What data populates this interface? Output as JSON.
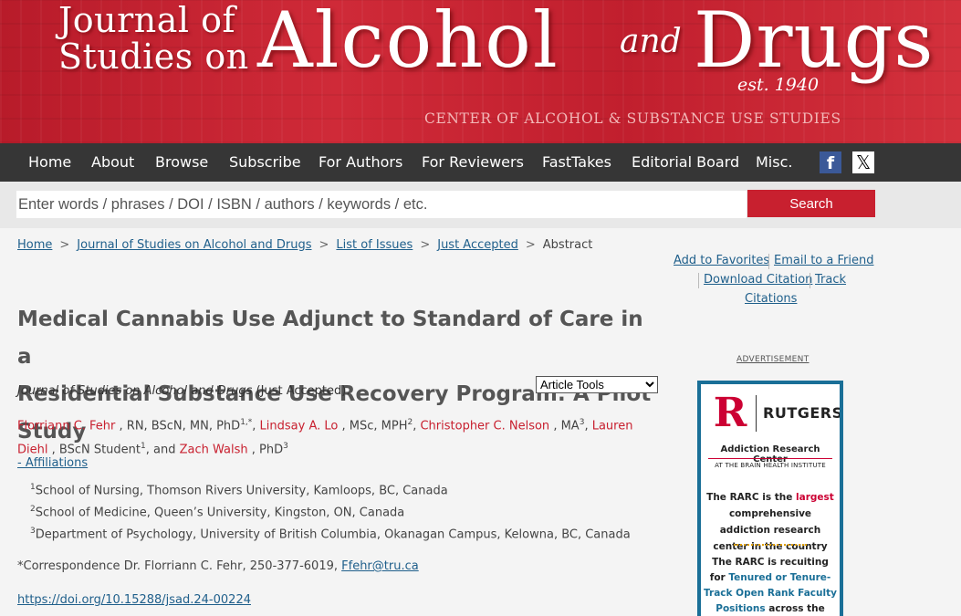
{
  "banner": {
    "journal_of": "Journal of",
    "studies_on": "Studies on",
    "alcohol": "Alcohol",
    "and": "and",
    "drugs": "Drugs",
    "est": "est. 1940",
    "center": "CENTER OF ALCOHOL & SUBSTANCE USE STUDIES"
  },
  "nav": {
    "items": [
      "Home",
      "About",
      "Browse",
      "Subscribe",
      "For Authors",
      "For Reviewers",
      "FastTakes",
      "Editorial Board",
      "Misc."
    ],
    "facebook": "f",
    "x": "𝕏"
  },
  "search": {
    "placeholder": "Enter words / phrases / DOI / ISBN / authors / keywords / etc.",
    "button": "Search"
  },
  "breadcrumb": {
    "home": "Home",
    "journal": "Journal of Studies on Alcohol and Drugs",
    "issues": "List of Issues",
    "accepted": "Just Accepted",
    "current": "Abstract"
  },
  "actions": {
    "favorites": "Add to Favorites",
    "email": "Email to a Friend",
    "download": "Download Citation",
    "track": "Track",
    "citations": "Citations"
  },
  "article": {
    "title_line1": "Medical Cannabis Use Adjunct to Standard of Care in a",
    "title_line2": "Residential Substance Use Recovery Program: A Pilot Study",
    "journal": "Journal of Studies on Alcohol and Drugs",
    "status": "(Just Accepted).",
    "tools_selected": "Article Tools",
    "authors": [
      {
        "name": "Florriann C. Fehr",
        "cred": " , RN, BScN, MN, PhD",
        "sup": "1,*"
      },
      {
        "name": "Lindsay A. Lo",
        "cred": " , MSc, MPH",
        "sup": "2"
      },
      {
        "name": "Christopher C. Nelson",
        "cred": " , MA",
        "sup": "3"
      },
      {
        "name": "Lauren Diehl",
        "cred": " , BScN Student",
        "sup": "1"
      },
      {
        "name": "Zach Walsh",
        "cred": " , PhD",
        "sup": "3"
      }
    ],
    "and_word": "and",
    "affiliations_toggle": "- Affiliations",
    "affiliations": [
      {
        "sup": "1",
        "text": "School of Nursing, Thomson Rivers University, Kamloops, BC, Canada"
      },
      {
        "sup": "2",
        "text": "School of Medicine, Queen’s University, Kingston, ON, Canada"
      },
      {
        "sup": "3",
        "text": "Department of Psychology, University of British Columbia, Okanagan Campus, Kelowna, BC, Canada"
      }
    ],
    "correspondence_text": "*Correspondence Dr. Florriann C. Fehr, 250-377-6019,",
    "correspondence_email": "Ffehr@tru.ca",
    "doi": "https://doi.org/10.15288/jsad.24-00224"
  },
  "ad": {
    "label": "ADVERTISEMENT",
    "logo_r": "R",
    "logo_text": "RUTGERS",
    "center": "Addiction Research Center",
    "center_sub": "AT THE BRAIN HEALTH INSTITUTE",
    "p1_a": "The RARC is the",
    "p1_red": "largest",
    "p1_b": "comprehensive addiction research center in the country",
    "p2_a": "The RARC is recuiting for",
    "p2_blue": "Tenured or Tenure-Track Open Rank Faculty Positions",
    "p2_b": "across the translational spectrum:"
  },
  "colors": {
    "brand_red": "#c8202f",
    "nav_bg": "#363636",
    "link_blue": "#1f5f8b"
  }
}
